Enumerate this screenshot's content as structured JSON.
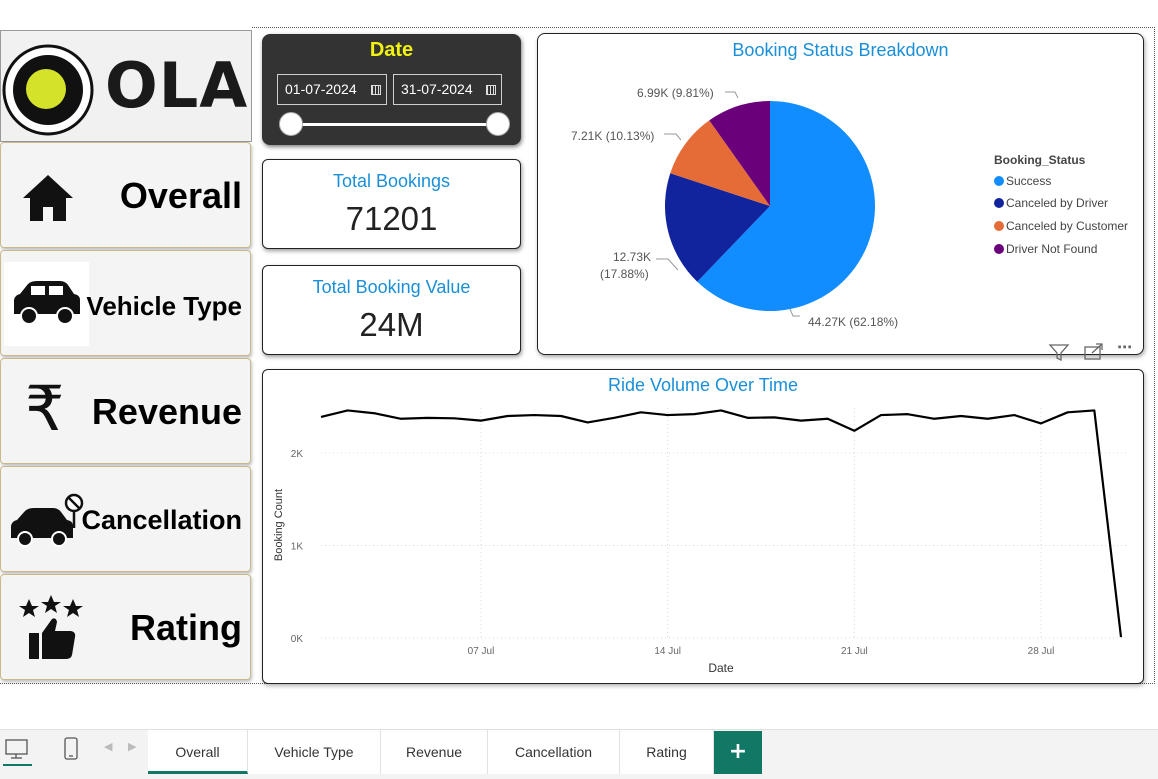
{
  "slicer": {
    "title": "Date",
    "start_date": "01-07-2024",
    "end_date": "31-07-2024"
  },
  "brand": {
    "logo_text": "OLA"
  },
  "nav": {
    "overall": "Overall",
    "vehicle_type": "Vehicle Type",
    "revenue": "Revenue",
    "cancellation": "Cancellation",
    "rating": "Rating"
  },
  "kpis": {
    "total_bookings": {
      "label": "Total Bookings",
      "value": "71201"
    },
    "total_booking_value": {
      "label": "Total Booking Value",
      "value": "24M"
    }
  },
  "pie": {
    "title": "Booking Status Breakdown",
    "legend_title": "Booking_Status",
    "slices": [
      {
        "label": "Success",
        "value": 44270,
        "display": "44.27K (62.18%)",
        "color": "#118dff"
      },
      {
        "label": "Canceled by Driver",
        "value": 12730,
        "display_line1": "12.73K",
        "display_line2": "(17.88%)",
        "color": "#12239e"
      },
      {
        "label": "Canceled by Customer",
        "value": 7210,
        "display": "7.21K (10.13%)",
        "color": "#e66c37"
      },
      {
        "label": "Driver Not Found",
        "value": 6990,
        "display": "6.99K (9.81%)",
        "color": "#6b007b"
      }
    ]
  },
  "chart_data": {
    "type": "line",
    "title": "Ride Volume Over Time",
    "xlabel": "Date",
    "ylabel": "Booking Count",
    "x_ticks": [
      "07 Jul",
      "14 Jul",
      "21 Jul",
      "28 Jul"
    ],
    "y_ticks": [
      "0K",
      "1K",
      "2K"
    ],
    "ylim": [
      0,
      2600
    ],
    "grid": true,
    "x": [
      "2024-07-01",
      "2024-07-02",
      "2024-07-03",
      "2024-07-04",
      "2024-07-05",
      "2024-07-06",
      "2024-07-07",
      "2024-07-08",
      "2024-07-09",
      "2024-07-10",
      "2024-07-11",
      "2024-07-12",
      "2024-07-13",
      "2024-07-14",
      "2024-07-15",
      "2024-07-16",
      "2024-07-17",
      "2024-07-18",
      "2024-07-19",
      "2024-07-20",
      "2024-07-21",
      "2024-07-22",
      "2024-07-23",
      "2024-07-24",
      "2024-07-25",
      "2024-07-26",
      "2024-07-27",
      "2024-07-28",
      "2024-07-29",
      "2024-07-30",
      "2024-07-31"
    ],
    "values": [
      2390,
      2460,
      2430,
      2370,
      2380,
      2375,
      2350,
      2400,
      2410,
      2400,
      2330,
      2380,
      2440,
      2410,
      2420,
      2460,
      2380,
      2385,
      2350,
      2370,
      2240,
      2410,
      2420,
      2370,
      2400,
      2370,
      2410,
      2320,
      2440,
      2460,
      10
    ],
    "color": "#000000"
  },
  "tabs": [
    "Overall",
    "Vehicle Type",
    "Revenue",
    "Cancellation",
    "Rating"
  ],
  "add_tab": "+"
}
